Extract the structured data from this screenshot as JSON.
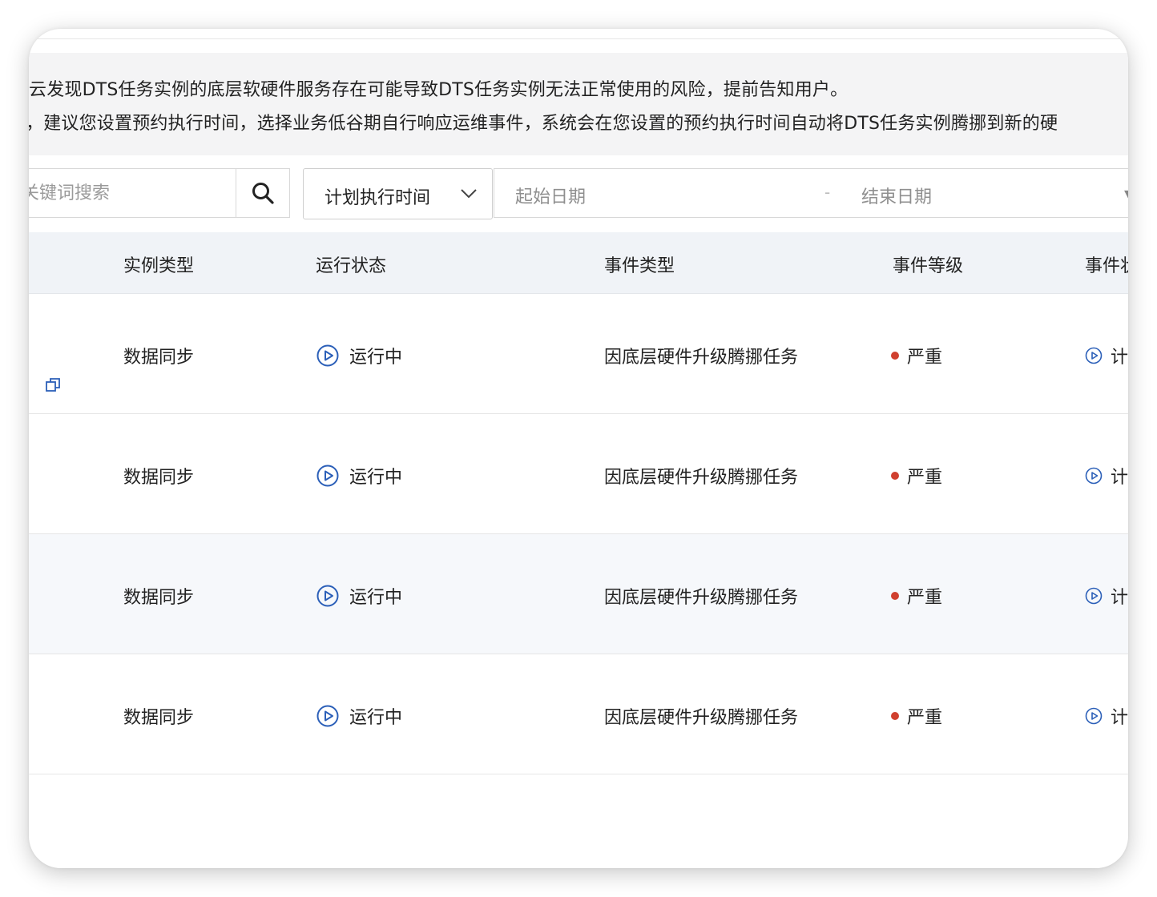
{
  "notice": {
    "line1": "云发现DTS任务实例的底层软硬件服务存在可能导致DTS任务实例无法正常使用的风险，提前告知用户。",
    "line2": "，建议您设置预约执行时间，选择业务低谷期自行响应运维事件，系统会在您设置的预约执行时间自动将DTS任务实例腾挪到新的硬"
  },
  "filters": {
    "search_placeholder": "关键词搜索",
    "time_select": "计划执行时间",
    "start_placeholder": "起始日期",
    "separator": "-",
    "end_placeholder": "结束日期"
  },
  "table": {
    "headers": {
      "instance_type": "实例类型",
      "run_status": "运行状态",
      "event_type": "事件类型",
      "event_level": "事件等级",
      "event_status": "事件状"
    },
    "rows": [
      {
        "instance_type": "数据同步",
        "run_status": "运行中",
        "event_type": "因底层硬件升级腾挪任务",
        "event_level": "严重",
        "event_status": "计"
      },
      {
        "instance_type": "数据同步",
        "run_status": "运行中",
        "event_type": "因底层硬件升级腾挪任务",
        "event_level": "严重",
        "event_status": "计"
      },
      {
        "instance_type": "数据同步",
        "run_status": "运行中",
        "event_type": "因底层硬件升级腾挪任务",
        "event_level": "严重",
        "event_status": "计"
      },
      {
        "instance_type": "数据同步",
        "run_status": "运行中",
        "event_type": "因底层硬件升级腾挪任务",
        "event_level": "严重",
        "event_status": "计"
      }
    ]
  },
  "icons": {
    "search": "search-icon",
    "chevron": "chevron-down-icon",
    "status": "play-circle-icon",
    "copy": "copy-icon"
  },
  "colors": {
    "status_blue": "#2b5fb8",
    "severity_red": "#d0402f",
    "header_bg": "#f0f3f7",
    "notice_bg": "#f4f4f5"
  }
}
